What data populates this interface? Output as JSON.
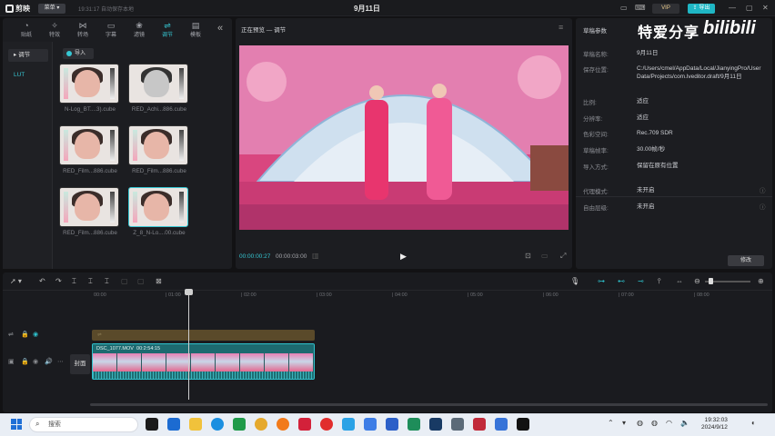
{
  "titlebar": {
    "app_name": "剪映",
    "menu_label": "菜单",
    "autosave": "19:31:17 自动保存本地",
    "title": "9月11日",
    "vip_label": "VIP",
    "export_label": "导出"
  },
  "media": {
    "tabs": [
      {
        "label": "贴纸"
      },
      {
        "label": "特效"
      },
      {
        "label": "转场"
      },
      {
        "label": "字幕"
      },
      {
        "label": "滤镜"
      },
      {
        "label": "调节",
        "active": true
      },
      {
        "label": "模板"
      }
    ],
    "sidebar": [
      "调节",
      "LUT"
    ],
    "import_label": "导入",
    "luts": [
      {
        "name": "N-Log_BT....3).cube"
      },
      {
        "name": "RED_Achi...886.cube"
      },
      {
        "name": "RED_Film...886.cube"
      },
      {
        "name": "RED_Film...886.cube"
      },
      {
        "name": "RED_Film...886.cube"
      },
      {
        "name": "Z_8_N-Lo....00.cube"
      }
    ]
  },
  "preview": {
    "title": "正在预览 — 调节",
    "current_time": "00:00:00:27",
    "total_time": "00:00:03:00"
  },
  "properties": {
    "title": "草稿参数",
    "watermark": "特爱分享",
    "bili": "bilibili",
    "rows": [
      {
        "label": "草稿名称:",
        "value": "9月11日"
      },
      {
        "label": "保存位置:",
        "value": "C:/Users/cmel/AppData/Local/JianyingPro/User Data/Projects/com.lveditor.draft/9月11日"
      },
      {
        "label": "比例:",
        "value": "适应"
      },
      {
        "label": "分辨率:",
        "value": "适应"
      },
      {
        "label": "色彩空间:",
        "value": "Rec.709 SDR"
      },
      {
        "label": "草稿帧率:",
        "value": "30.00帧/秒"
      },
      {
        "label": "导入方式:",
        "value": "保留在原有位置"
      },
      {
        "label": "代理模式:",
        "value": "未开启"
      },
      {
        "label": "自由层级:",
        "value": "未开启"
      }
    ],
    "modify_label": "修改"
  },
  "timeline": {
    "ticks": [
      "00:00",
      "| 01:00",
      "| 02:00",
      "| 03:00",
      "| 04:00",
      "| 05:00",
      "| 06:00",
      "| 07:00",
      "| 08:00"
    ],
    "clip_name": "DSC_1077.MOV",
    "clip_duration": "00:2:54:15",
    "cover_label": "封面"
  },
  "taskbar": {
    "search_placeholder": "搜索",
    "time": "19:32:03",
    "date": "2024/9/12"
  }
}
